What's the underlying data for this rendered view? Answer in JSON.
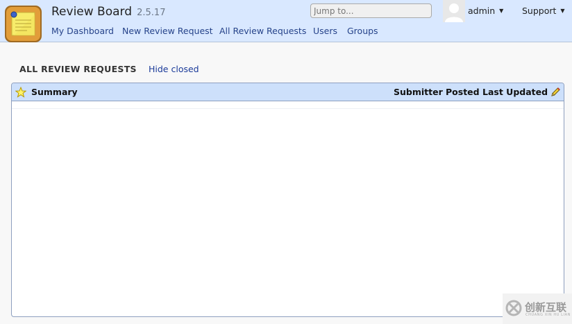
{
  "header": {
    "app_name": "Review Board",
    "app_version": "2.5.17",
    "nav": [
      "My Dashboard",
      "New Review Request",
      "All Review Requests",
      "Users",
      "Groups"
    ],
    "search_placeholder": "Jump to...",
    "user": "admin",
    "support": "Support"
  },
  "page": {
    "heading": "ALL REVIEW REQUESTS",
    "hide_closed": "Hide closed"
  },
  "grid": {
    "columns": {
      "summary": "Summary",
      "submitter": "Submitter",
      "posted": "Posted",
      "last_updated": "Last Updated"
    },
    "rows": []
  },
  "watermark": {
    "text": "创新互联",
    "sub": "CHUANG XIN HU LIAN"
  },
  "colors": {
    "header_bg": "#d9e8ff",
    "grid_head_bg": "#cde0fb",
    "link": "#26438a"
  },
  "icons": {
    "logo": "sticky-note-logo-icon",
    "star": "star-icon",
    "edit": "pencil-icon",
    "avatar": "user-avatar-icon"
  }
}
